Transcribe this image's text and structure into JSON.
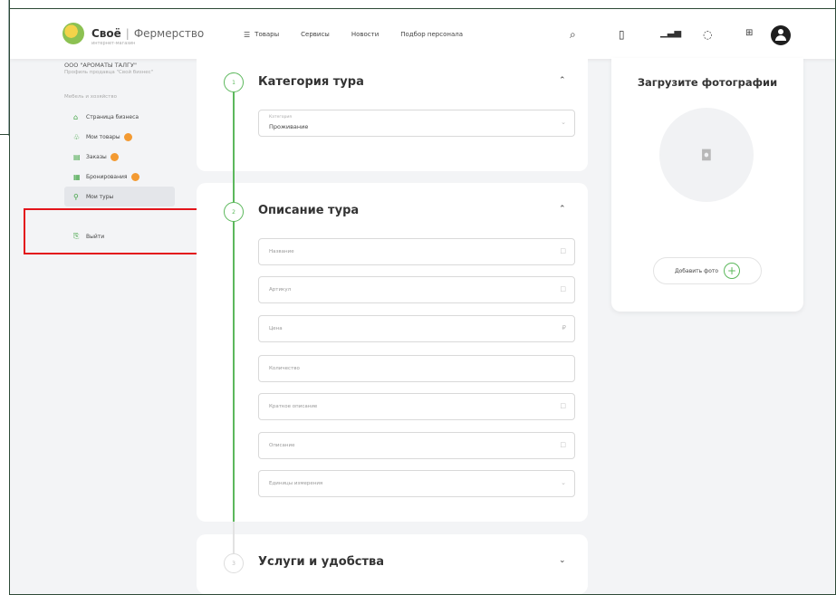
{
  "header": {
    "brand": "Своё",
    "brand_separator": "|",
    "brand_sub": "Фермерство",
    "brand_tagline": "интернет-магазин",
    "nav_items": [
      "Товары",
      "Сервисы",
      "Новости",
      "Подбор персонала"
    ],
    "icons": [
      "search-icon",
      "bookmark-icon",
      "chart-icon",
      "cart-icon",
      "grid-icon",
      "user-icon"
    ]
  },
  "sidebar": {
    "org_name": "ООО \"АРОМАТЫ ТАЛГУ\"",
    "org_sub": "Профиль продавца \"Свой бизнес\"",
    "caption": "Мебель и хозяйство",
    "items": [
      {
        "label": "Страница бизнеса",
        "icon": "store-icon",
        "badge": false
      },
      {
        "label": "Мои товары",
        "icon": "goods-icon",
        "badge": true
      },
      {
        "label": "Заказы",
        "icon": "orders-icon",
        "badge": true
      },
      {
        "label": "Бронирования",
        "icon": "booking-icon",
        "badge": true
      },
      {
        "label": "Мои туры",
        "icon": "pin-icon",
        "badge": false
      }
    ],
    "logout": "Выйти"
  },
  "form": {
    "section1": {
      "step": "1",
      "title": "Категория тура",
      "category_label": "Категория",
      "category_value": "Проживание"
    },
    "section2": {
      "step": "2",
      "title": "Описание тура",
      "fields": [
        {
          "placeholder": "Название",
          "icon": "□"
        },
        {
          "placeholder": "Артикул",
          "icon": "□"
        },
        {
          "placeholder": "Цена",
          "icon": "₽"
        },
        {
          "placeholder": "Количество",
          "icon": ""
        },
        {
          "placeholder": "Краткое описание",
          "icon": "□"
        },
        {
          "placeholder": "Описание",
          "icon": "□"
        },
        {
          "placeholder": "Единицы измерения",
          "icon": "⌄"
        }
      ]
    },
    "section3": {
      "step": "3",
      "title": "Услуги и удобства"
    }
  },
  "photo": {
    "title": "Загрузите фотографии",
    "add_label": "Добавить фото"
  }
}
